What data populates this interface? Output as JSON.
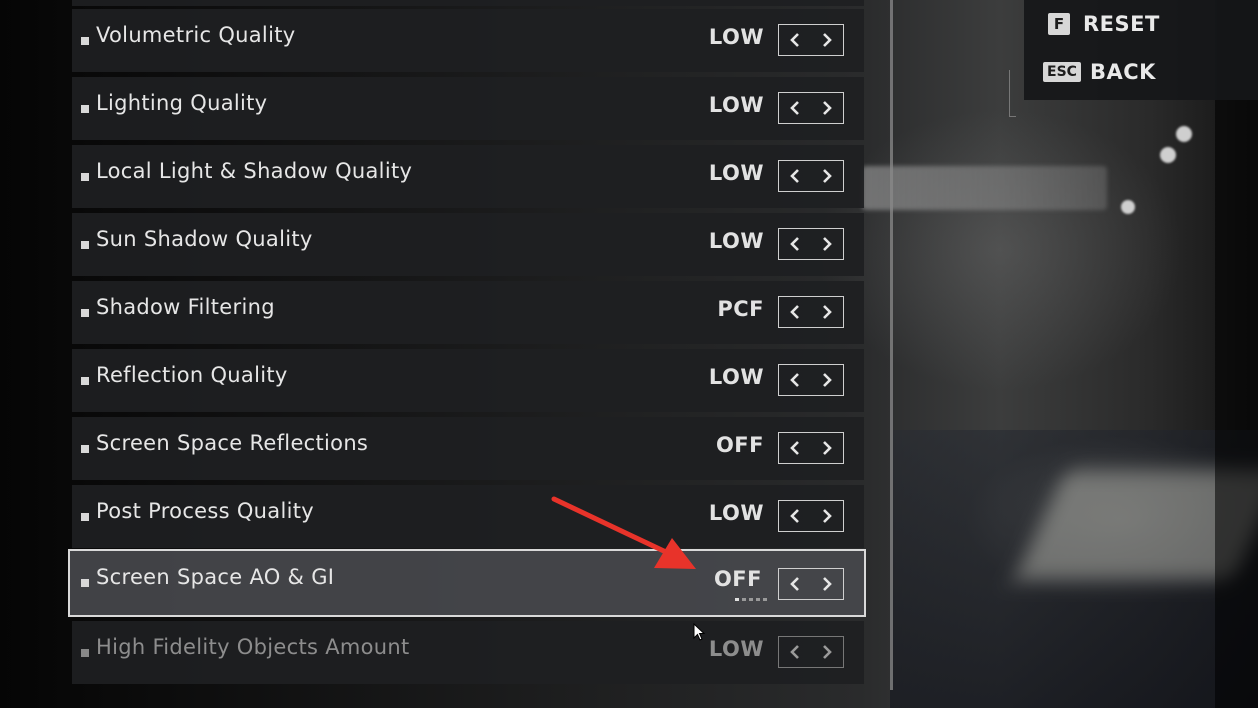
{
  "settings": [
    {
      "label": "Volumetric Quality",
      "value": "LOW"
    },
    {
      "label": "Lighting Quality",
      "value": "LOW"
    },
    {
      "label": "Local Light & Shadow Quality",
      "value": "LOW"
    },
    {
      "label": "Sun Shadow Quality",
      "value": "LOW"
    },
    {
      "label": "Shadow Filtering",
      "value": "PCF"
    },
    {
      "label": "Reflection Quality",
      "value": "LOW"
    },
    {
      "label": "Screen Space Reflections",
      "value": "OFF"
    },
    {
      "label": "Post Process Quality",
      "value": "LOW"
    },
    {
      "label": "Screen Space AO & GI",
      "value": "OFF"
    },
    {
      "label": "High Fidelity Objects Amount",
      "value": "LOW"
    }
  ],
  "selected_index": 8,
  "controls": {
    "reset": {
      "key": "F",
      "label": "RESET"
    },
    "back": {
      "key": "ESC",
      "label": "BACK"
    }
  },
  "annotation": {
    "color": "#e8332a"
  }
}
